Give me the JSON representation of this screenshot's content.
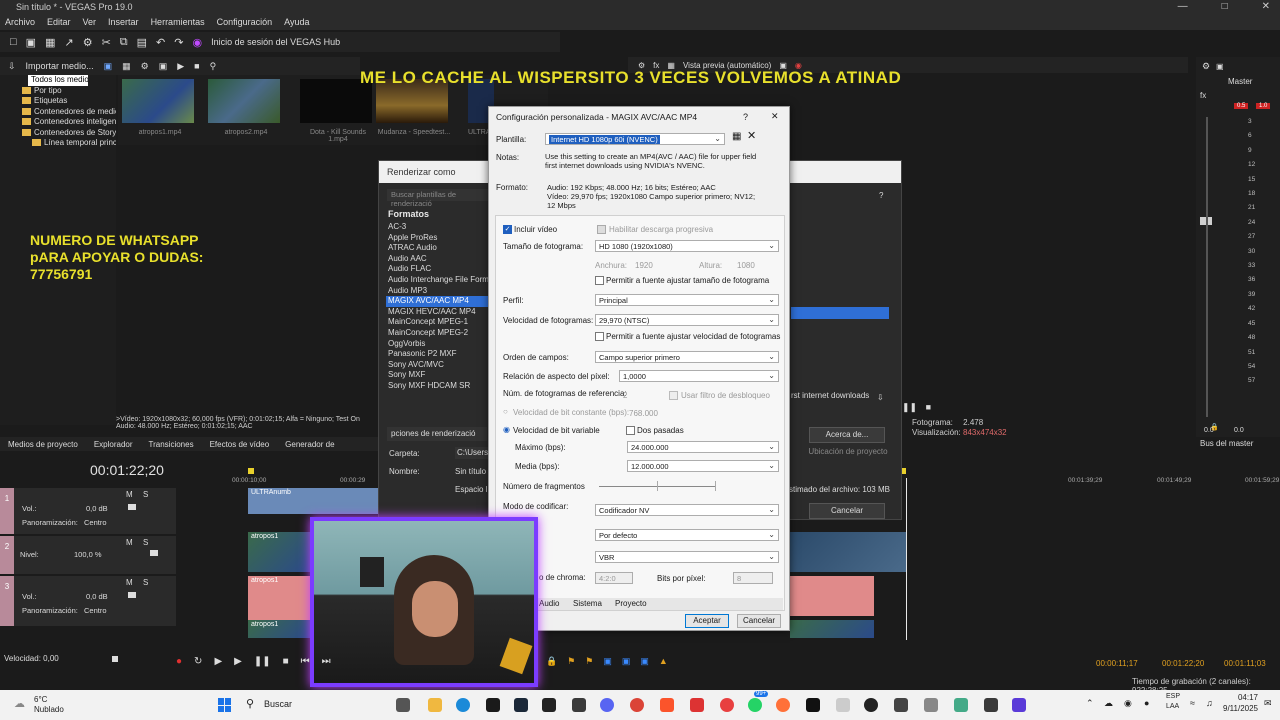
{
  "window": {
    "title": "Sin título * - VEGAS Pro 19.0"
  },
  "menu": [
    "Archivo",
    "Editar",
    "Ver",
    "Insertar",
    "Herramientas",
    "Configuración",
    "Ayuda"
  ],
  "toolbar": {
    "hub_label": "Inicio de sesión del VEGAS Hub"
  },
  "explorer": {
    "import_label": "Importar medio..."
  },
  "tree": [
    "Todos los medios",
    "Por tipo",
    "Etiquetas",
    "Contenedores de medios",
    "Contenedores inteligentes",
    "Contenedores de Storybo...",
    "Línea temporal princip..."
  ],
  "thumbs": [
    {
      "caption": "atropos1.mp4"
    },
    {
      "caption": "atropos2.mp4"
    },
    {
      "caption": "Dota - Kill Sounds 1.mp4"
    },
    {
      "caption": "Mudanza - Speedtest..."
    },
    {
      "caption": "ULTRA..."
    }
  ],
  "overlay": {
    "top_text": "ME LO CACHE AL WISPERSITO 3 VECES VOLVEMOS A ATINAD",
    "left_text_1": "NUMERO DE WHATSAPP",
    "left_text_2": "pARA APOYAR O DUDAS:",
    "left_text_3": "77756791"
  },
  "preview": {
    "label": "Vista previa (automático)",
    "frame_label": "Fotograma:",
    "frame_value": "2.478",
    "view_label": "Visualización:",
    "view_value": "843x474x32"
  },
  "master": {
    "label": "Master",
    "peak_left": "0.5",
    "peak_right": "1.0",
    "scale": [
      "3",
      "6",
      "9",
      "12",
      "15",
      "18",
      "21",
      "24",
      "27",
      "30",
      "33",
      "36",
      "39",
      "42",
      "45",
      "48",
      "51",
      "54",
      "57"
    ],
    "bottom_left": "0.0",
    "bottom_right": "0.0",
    "bus_label": "Bus del master"
  },
  "media_info": {
    "line1": ">Vídeo: 1920x1080x32; 60,000 fps (VFR); 0:01:02;15; Alfa = Ninguno; Test On",
    "line2": "Audio: 48.000 Hz; Estéreo; 0:01:02;15; AAC"
  },
  "tabs": [
    "Medios de proyecto",
    "Explorador",
    "Transiciones",
    "Efectos de vídeo",
    "Generador de"
  ],
  "timeline": {
    "timecode": "00:01:22;20",
    "ruler": [
      "00:00:10;00",
      "00:00:29",
      "00:01:39;29",
      "00:01:49;29",
      "00:01:59;29"
    ],
    "speed": "Velocidad: 0,00",
    "pos1": "00:00:11;17",
    "pos2": "00:01:22;20",
    "pos3": "00:01:11;03",
    "record_time": "Tiempo de grabación (2 canales): 922:28:25"
  },
  "tracks": [
    {
      "num": "1",
      "vol_label": "Vol.:",
      "vol": "0,0 dB",
      "pan_label": "Panoramización:",
      "pan": "Centro"
    },
    {
      "num": "2",
      "level_label": "Nivel:",
      "level": "100,0 %"
    },
    {
      "num": "3",
      "vol_label": "Vol.:",
      "vol": "0,0 dB",
      "pan_label": "Panoramización:",
      "pan": "Centro"
    }
  ],
  "clips": {
    "c1": "ULTRAnumb",
    "c2": "atropos1",
    "c3": "atropos1",
    "c4": "atropos1"
  },
  "render": {
    "title": "Renderizar como",
    "search_placeholder": "Buscar plantillas de renderizació",
    "formats_label": "Formatos",
    "formats": [
      "AC-3",
      "Apple ProRes",
      "ATRAC Audio",
      "Audio AAC",
      "Audio FLAC",
      "Audio Interchange File Format",
      "Audio MP3",
      "MAGIX AVC/AAC MP4",
      "MAGIX HEVC/AAC MP4",
      "MainConcept MPEG-1",
      "MainConcept MPEG-2",
      "OggVorbis",
      "Panasonic P2 MXF",
      "Sony AVC/MVC",
      "Sony MXF",
      "Sony MXF HDCAM SR"
    ],
    "options_label": "pciones de renderizació",
    "folder_label": "Carpeta:",
    "folder_value": "C:\\Users\\",
    "name_label": "Nombre:",
    "name_value": "Sin título",
    "space_label": "Espacio li",
    "browse_button": "Acerca de...",
    "location_button": "Ubicación de proyecto",
    "estimate": "stimado del archivo: 103 MB",
    "cancel": "Cancelar",
    "internet_text": "rst internet downloads"
  },
  "dialog": {
    "title": "Configuración personalizada - MAGIX AVC/AAC MP4",
    "help": "?",
    "close": "✕",
    "template_label": "Plantilla:",
    "template_value": "Internet HD 1080p 60i (NVENC)",
    "notes_label": "Notas:",
    "notes_value": "Use this setting to create an MP4(AVC / AAC) file for upper field first internet downloads using NVIDIA's NVENC.",
    "format_label": "Formato:",
    "format_l1": "Audio: 192 Kbps; 48.000 Hz; 16 bits; Estéreo; AAC",
    "format_l2": "Vídeo: 29,970 fps; 1920x1080 Campo superior primero; NV12;",
    "format_l3": "12 Mbps",
    "include_video": "Incluir vídeo",
    "progressive": "Habilitar descarga progresiva",
    "frame_size_label": "Tamaño de fotograma:",
    "frame_size_value": "HD 1080 (1920x1080)",
    "width_label": "Anchura:",
    "width_value": "1920",
    "height_label": "Altura:",
    "height_value": "1080",
    "allow_frame": "Permitir a fuente ajustar tamaño de fotograma",
    "profile_label": "Perfil:",
    "profile_value": "Principal",
    "fps_label": "Velocidad de fotogramas:",
    "fps_value": "29,970 (NTSC)",
    "allow_fps": "Permitir a fuente ajustar velocidad de fotogramas",
    "field_order_label": "Orden de campos:",
    "field_order_value": "Campo superior primero",
    "aspect_label": "Relación de aspecto del píxel:",
    "aspect_value": "1,0000",
    "ref_label": "Núm. de fotogramas de referencia:",
    "ref_value": "2",
    "deblock": "Usar filtro de desbloqueo",
    "cbr_label": "Velocidad de bit constante (bps):",
    "cbr_value": "768.000",
    "vbr_label": "Velocidad de bit variable",
    "two_pass": "Dos pasadas",
    "max_label": "Máximo (bps):",
    "max_value": "24.000.000",
    "avg_label": "Media (bps):",
    "avg_value": "12.000.000",
    "slices_label": "Número de fragmentos",
    "encode_label": "Modo de codificar:",
    "encode_value": "Codificador NV",
    "preset_value": "Por defecto",
    "rc_value": "VBR",
    "chroma_label": "o de chroma:",
    "chroma_value": "4:2:0",
    "bits_label": "Bits por píxel:",
    "bits_value": "8",
    "tab_audio": "Audio",
    "tab_system": "Sistema",
    "tab_project": "Proyecto",
    "ok": "Aceptar",
    "cancel": "Cancelar"
  },
  "taskbar": {
    "weather_temp": "6°C",
    "weather_desc": "Nublado",
    "search_placeholder": "Buscar",
    "lang1": "ESP",
    "lang2": "LAA",
    "time": "04:17",
    "date": "9/11/2025",
    "badge": "99+"
  }
}
